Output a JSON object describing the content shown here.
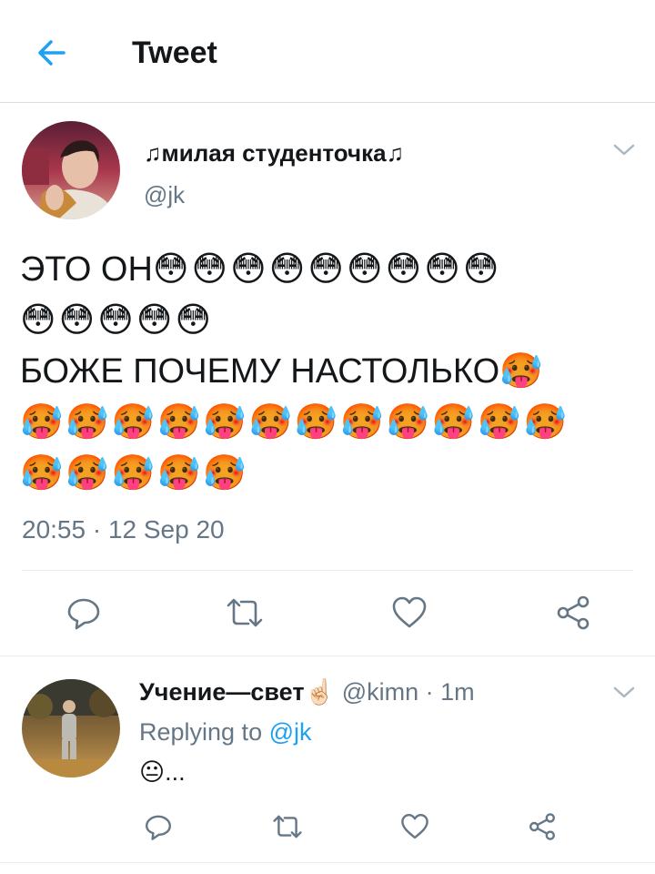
{
  "header": {
    "title": "Tweet",
    "back_icon": "arrow-left-icon",
    "accent": "#1da1f2"
  },
  "tweet": {
    "author_name": "♫милая студенточка♫",
    "author_handle": "@jk",
    "line1": "ЭТО ОН",
    "line1_emoji": "😳😳😳😳😳😳😳😳😳",
    "line2_emoji": "😳😳😳😳😳",
    "line3": "БОЖЕ ПОЧЕМУ НАСТОЛЬКО",
    "line3_emoji": "🥵",
    "line4_emoji": "🥵🥵🥵🥵🥵🥵🥵🥵🥵🥵🥵🥵",
    "line5_emoji": "🥵🥵🥵🥵🥵",
    "timestamp": "20:55 · 12 Sep 20",
    "actions": [
      "reply-icon",
      "retweet-icon",
      "like-icon",
      "share-icon"
    ]
  },
  "reply": {
    "author_name": "Учение—свет",
    "name_emoji": "☝🏻",
    "meta": "@kimn · 1m",
    "replying_prefix": "Replying to",
    "replying_to": "@jk",
    "text": "😐..."
  },
  "colors": {
    "text": "#14171a",
    "secondary": "#657786",
    "divider": "#e6ecf0",
    "accent": "#1da1f2"
  }
}
